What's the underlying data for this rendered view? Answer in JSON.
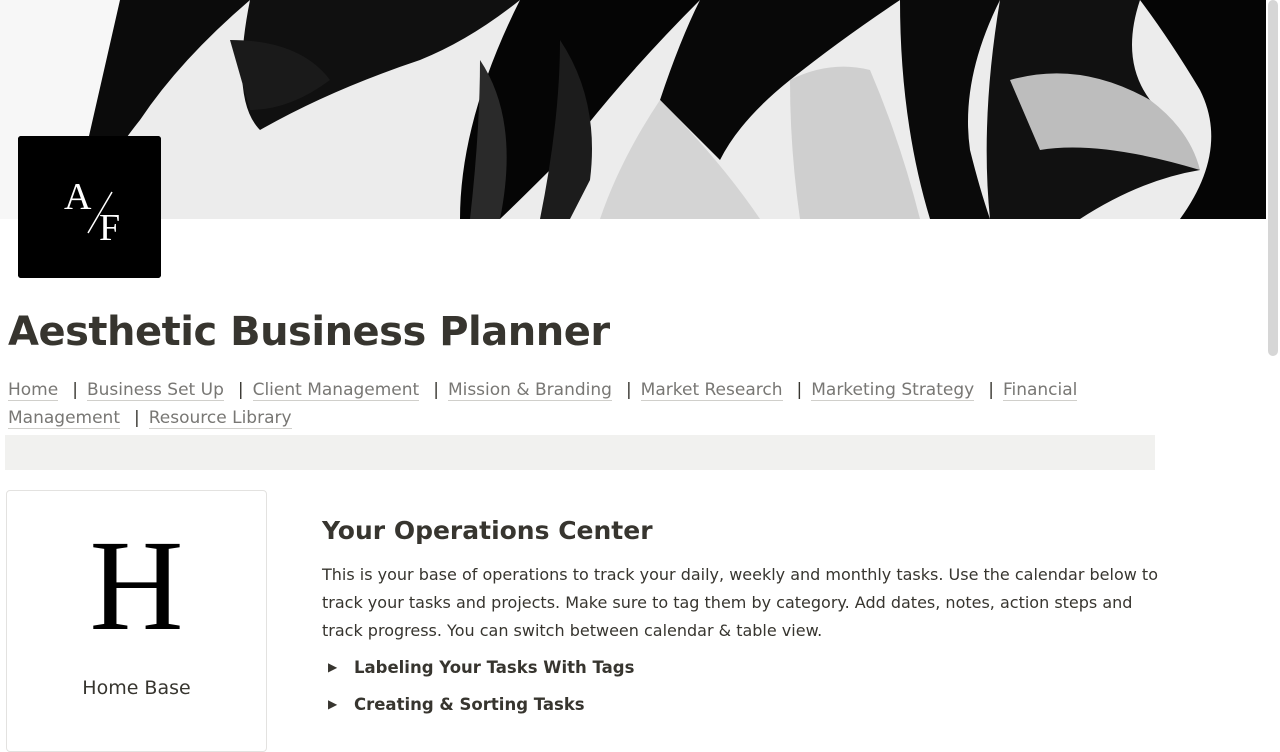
{
  "cover": {
    "image": "black-and-white-abstract-waves"
  },
  "logo": {
    "text": "A/F"
  },
  "page": {
    "title": "Aesthetic Business Planner"
  },
  "nav": {
    "links": [
      "Home",
      "Business Set Up",
      "Client Management",
      "Mission & Branding",
      "Market Research",
      "Marketing Strategy",
      "Financial",
      "Management",
      "Resource Library"
    ],
    "separator": "|"
  },
  "card": {
    "letter": "H",
    "label": "Home Base"
  },
  "section": {
    "title": "Your Operations Center",
    "body": "This is your base of operations to track your daily, weekly and monthly tasks. Use the calendar below to track your tasks and projects. Make sure to tag them by category. Add dates, notes, action steps and track progress. You can switch between calendar & table view.",
    "toggles": [
      "Labeling Your Tasks With Tags",
      "Creating & Sorting Tasks"
    ]
  },
  "colors": {
    "text": "#37352f",
    "link": "#787774",
    "band": "#f1f1ef",
    "logo_bg": "#000000"
  }
}
